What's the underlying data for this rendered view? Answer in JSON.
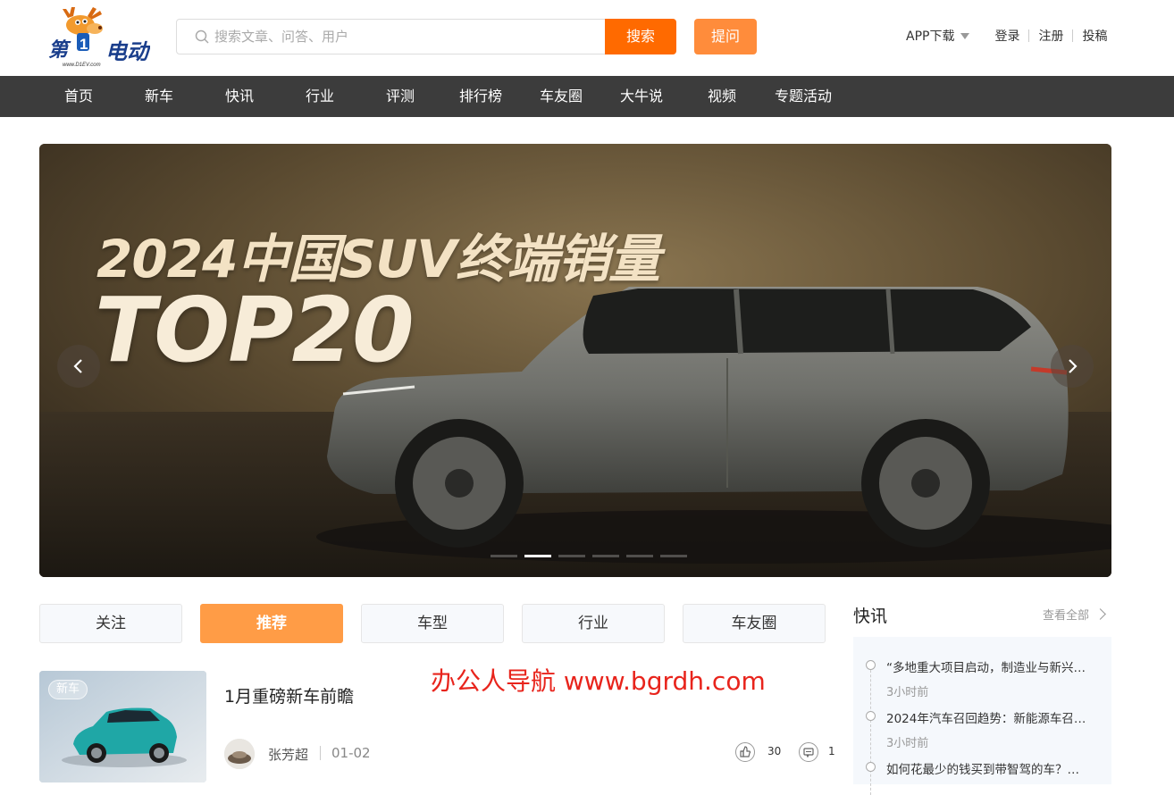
{
  "header": {
    "logo_text": "第1电动",
    "logo_url_text": "www.D1EV.com",
    "search_placeholder": "搜索文章、问答、用户",
    "search_button": "搜索",
    "ask_button": "提问",
    "app_download": "APP下载",
    "login": "登录",
    "register": "注册",
    "submit": "投稿",
    "brand_color": "#ff6a00"
  },
  "nav": {
    "items": [
      "首页",
      "新车",
      "快讯",
      "行业",
      "评测",
      "排行榜",
      "车友圈",
      "大牛说",
      "视频",
      "专题活动"
    ]
  },
  "banner": {
    "headline_line1": "2024中国SUV终端销量",
    "headline_line2": "TOP20",
    "active_slide": 2,
    "slide_count": 6
  },
  "tabs": {
    "items": [
      "关注",
      "推荐",
      "车型",
      "行业",
      "车友圈"
    ],
    "active": "推荐"
  },
  "article": {
    "badge": "新车",
    "title": "1月重磅新车前瞻",
    "author": "张芳超",
    "date": "01-02",
    "likes": "30",
    "comments": "1"
  },
  "watermark": "办公人导航 www.bgrdh.com",
  "sidebar": {
    "title": "快讯",
    "more": "查看全部",
    "news": [
      {
        "text": "“多地重大项目启动，制造业与新兴…",
        "time": "3小时前"
      },
      {
        "text": "2024年汽车召回趋势：新能源车召…",
        "time": "3小时前"
      },
      {
        "text": "如何花最少的钱买到带智驾的车？…",
        "time": ""
      }
    ]
  }
}
